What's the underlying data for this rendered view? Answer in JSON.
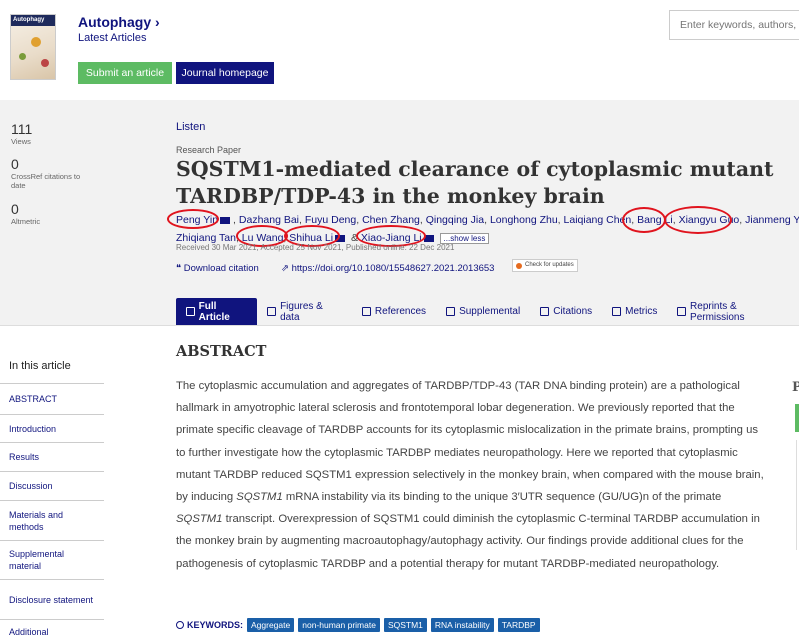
{
  "header": {
    "journal_name": "Autophagy",
    "latest_articles": "Latest Articles",
    "submit_label": "Submit an article",
    "homepage_label": "Journal homepage",
    "search_placeholder": "Enter keywords, authors, DOI",
    "cover_text": "Autophagy"
  },
  "metrics": [
    {
      "value": "111",
      "label": "Views"
    },
    {
      "value": "0",
      "label": "CrossRef citations to date"
    },
    {
      "value": "0",
      "label": "Altmetric"
    }
  ],
  "article": {
    "listen": "Listen",
    "paper_type": "Research Paper",
    "title_line1": "SQSTM1-mediated clearance of cytoplasmic mutant",
    "title_line2": "TARDBP/TDP-43 in the monkey brain",
    "authors_row1": [
      "Peng Yin",
      "Dazhang Bai",
      "Fuyu Deng",
      "Chen Zhang",
      "Qingqing Jia",
      "Longhong Zhu",
      "Laiqiang Chen",
      "Bang Li",
      "Xiangyu Guo",
      "Jianmeng Ye,"
    ],
    "authors_row2": [
      "Zhiqiang Tan",
      "Lu Wang",
      "Shihua Li",
      "Xiao-Jiang Li"
    ],
    "and": "&",
    "show_less": "...show less",
    "dates": "Received 30 Mar 2021, Accepted 25 Nov 2021, Published online: 22 Dec 2021",
    "download_citation": "Download citation",
    "doi": "https://doi.org/10.1080/15548627.2021.2013653",
    "check_updates": "Check for updates"
  },
  "tabs": [
    "Full Article",
    "Figures & data",
    "References",
    "Supplemental",
    "Citations",
    "Metrics",
    "Reprints & Permissions"
  ],
  "sidebar": {
    "title": "In this article",
    "items": [
      "ABSTRACT",
      "Introduction",
      "Results",
      "Discussion",
      "Materials and methods",
      "Supplemental material",
      "Disclosure statement",
      "Additional"
    ]
  },
  "abstract": {
    "heading": "ABSTRACT",
    "p1": "The cytoplasmic accumulation and aggregates of TARDBP/TDP-43 (TAR DNA binding protein) are a pathological hallmark in amyotrophic lateral sclerosis and frontotemporal lobar degeneration. We previously reported that the primate specific cleavage of TARDBP accounts for its cytoplasmic mislocalization in the primate brains, prompting us to further investigate how the cytoplasmic TARDBP mediates neuropathology. Here we reported that cytoplasmic mutant TARDBP reduced SQSTM1 expression selectively in the monkey brain, when compared with the mouse brain, by inducing ",
    "i1": "SQSTM1",
    "p2": " mRNA instability via its binding to the unique 3′UTR sequence (GU/UG)n of the primate ",
    "i2": "SQSTM1",
    "p3": " transcript. Overexpression of SQSTM1 could diminish the cytoplasmic C-terminal TARDBP accumulation in the monkey brain by augmenting macroautophagy/autophagy activity. Our findings provide additional clues for the pathogenesis of cytoplasmic TARDBP and a potential therapy for mutant TARDBP-mediated neuropathology."
  },
  "keywords": {
    "label": "KEYWORDS:",
    "tags": [
      "Aggregate",
      "non-human primate",
      "SQSTM1",
      "RNA instability",
      "TARDBP"
    ]
  },
  "right_edge_letter": "P",
  "colors": {
    "brand": "#10147e",
    "submit": "#5dbb63",
    "highlight": "#e0141e",
    "tag": "#1a5fa8"
  }
}
